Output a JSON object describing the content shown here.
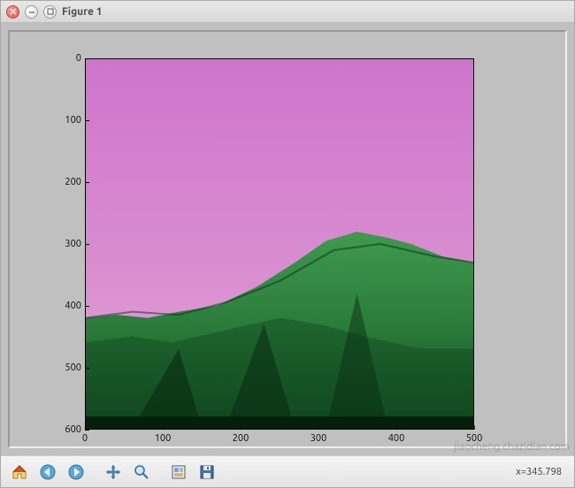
{
  "window": {
    "title": "Figure 1"
  },
  "plot": {
    "y_ticks": [
      "0",
      "100",
      "200",
      "300",
      "400",
      "500",
      "600"
    ],
    "x_ticks": [
      "0",
      "100",
      "200",
      "300",
      "400",
      "500"
    ],
    "xlim": [
      0,
      500
    ],
    "ylim": [
      600,
      0
    ]
  },
  "toolbar": {
    "icons": {
      "home": "home-icon",
      "back": "back-icon",
      "forward": "forward-icon",
      "pan": "pan-icon",
      "zoom": "zoom-icon",
      "subplots": "subplots-icon",
      "save": "save-icon"
    }
  },
  "status": {
    "coord": "x=345.798"
  },
  "watermark": "jiaocheng.chazidian.com"
}
